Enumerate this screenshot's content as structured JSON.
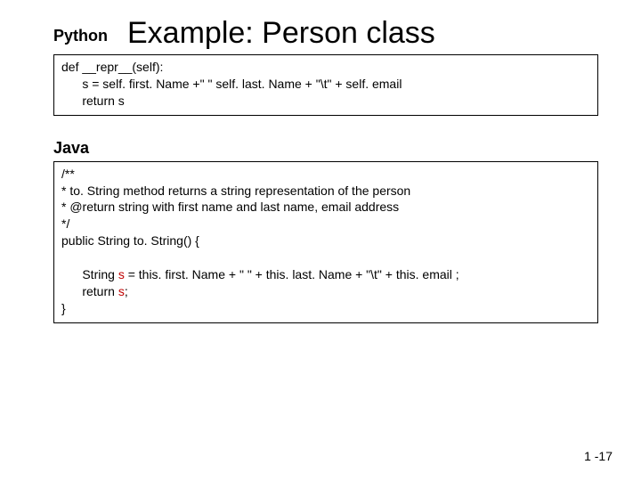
{
  "header": {
    "python_label": "Python",
    "title": "Example: Person class"
  },
  "python_code": {
    "line1": "def __repr__(self):",
    "line2": "      s = self. first. Name +\" \" self. last. Name + \"\\t\" + self. email",
    "line3": "      return s"
  },
  "java_label": "Java",
  "java_code": {
    "line1": "/**",
    "line2": "* to. String method returns a string representation of the person",
    "line3": "* @return string with first name and last name, email address",
    "line4": "*/",
    "line5": "public String to. String() {",
    "line6_prefix": "      String ",
    "line6_var": "s",
    "line6_rest": " = this. first. Name + \" \" + this. last. Name + \"\\t\" + this. email ;",
    "line7_prefix": "      return ",
    "line7_var": "s",
    "line7_rest": ";",
    "line8": "}"
  },
  "page_number": "1 -17"
}
